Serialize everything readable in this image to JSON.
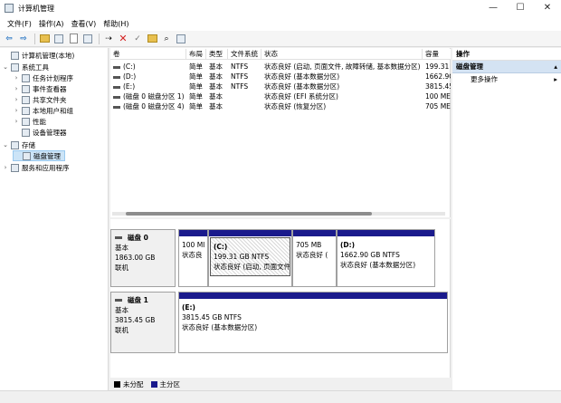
{
  "window": {
    "title": "计算机管理",
    "minimize": "—",
    "maximize": "☐",
    "close": "✕"
  },
  "menu": [
    "文件(F)",
    "操作(A)",
    "查看(V)",
    "帮助(H)"
  ],
  "tree": [
    {
      "label": "计算机管理(本地)",
      "chev": "",
      "level": 0,
      "selected": false
    },
    {
      "label": "系统工具",
      "chev": "⌄",
      "level": 1,
      "selected": false
    },
    {
      "label": "任务计划程序",
      "chev": "›",
      "level": 2,
      "selected": false
    },
    {
      "label": "事件查看器",
      "chev": "›",
      "level": 2,
      "selected": false
    },
    {
      "label": "共享文件夹",
      "chev": "›",
      "level": 2,
      "selected": false
    },
    {
      "label": "本地用户和组",
      "chev": "›",
      "level": 2,
      "selected": false
    },
    {
      "label": "性能",
      "chev": "›",
      "level": 2,
      "selected": false
    },
    {
      "label": "设备管理器",
      "chev": "",
      "level": 2,
      "selected": false
    },
    {
      "label": "存储",
      "chev": "⌄",
      "level": 1,
      "selected": false
    },
    {
      "label": "磁盘管理",
      "chev": "",
      "level": 2,
      "selected": true
    },
    {
      "label": "服务和应用程序",
      "chev": "›",
      "level": 1,
      "selected": false
    }
  ],
  "volumes": {
    "headers": [
      "卷",
      "布局",
      "类型",
      "文件系统",
      "状态",
      "容量"
    ],
    "rows": [
      [
        "(C:)",
        "简单",
        "基本",
        "NTFS",
        "状态良好 (启动, 页面文件, 故障转储, 基本数据分区)",
        "199.31"
      ],
      [
        "(D:)",
        "简单",
        "基本",
        "NTFS",
        "状态良好 (基本数据分区)",
        "1662.9C"
      ],
      [
        "(E:)",
        "简单",
        "基本",
        "NTFS",
        "状态良好 (基本数据分区)",
        "3815.45"
      ],
      [
        "(磁盘 0 磁盘分区 1)",
        "简单",
        "基本",
        "",
        "状态良好 (EFI 系统分区)",
        "100 ME"
      ],
      [
        "(磁盘 0 磁盘分区 4)",
        "简单",
        "基本",
        "",
        "状态良好 (恢复分区)",
        "705 ME"
      ]
    ]
  },
  "disks": [
    {
      "name": "磁盘 0",
      "type": "基本",
      "size": "1863.00 GB",
      "status": "联机",
      "partitions": [
        {
          "name": "",
          "size": "100 MI",
          "status": "状态良",
          "hatched": false
        },
        {
          "name": "(C:)",
          "size": "199.31 GB NTFS",
          "status": "状态良好 (启动, 页面文件",
          "hatched": true
        },
        {
          "name": "",
          "size": "705 MB",
          "status": "状态良好 (",
          "hatched": false
        },
        {
          "name": "(D:)",
          "size": "1662.90 GB NTFS",
          "status": "状态良好 (基本数据分区)",
          "hatched": false
        }
      ]
    },
    {
      "name": "磁盘 1",
      "type": "基本",
      "size": "3815.45 GB",
      "status": "联机",
      "partitions": [
        {
          "name": "(E:)",
          "size": "3815.45 GB NTFS",
          "status": "状态良好 (基本数据分区)",
          "hatched": false
        }
      ]
    }
  ],
  "legend": [
    {
      "label": "未分配",
      "color": "#000000"
    },
    {
      "label": "主分区",
      "color": "#1a1a8c"
    }
  ],
  "actions": {
    "title": "操作",
    "section": "磁盘管理",
    "section_arrow": "▴",
    "items": [
      {
        "label": "更多操作",
        "arrow": "▸"
      }
    ]
  }
}
